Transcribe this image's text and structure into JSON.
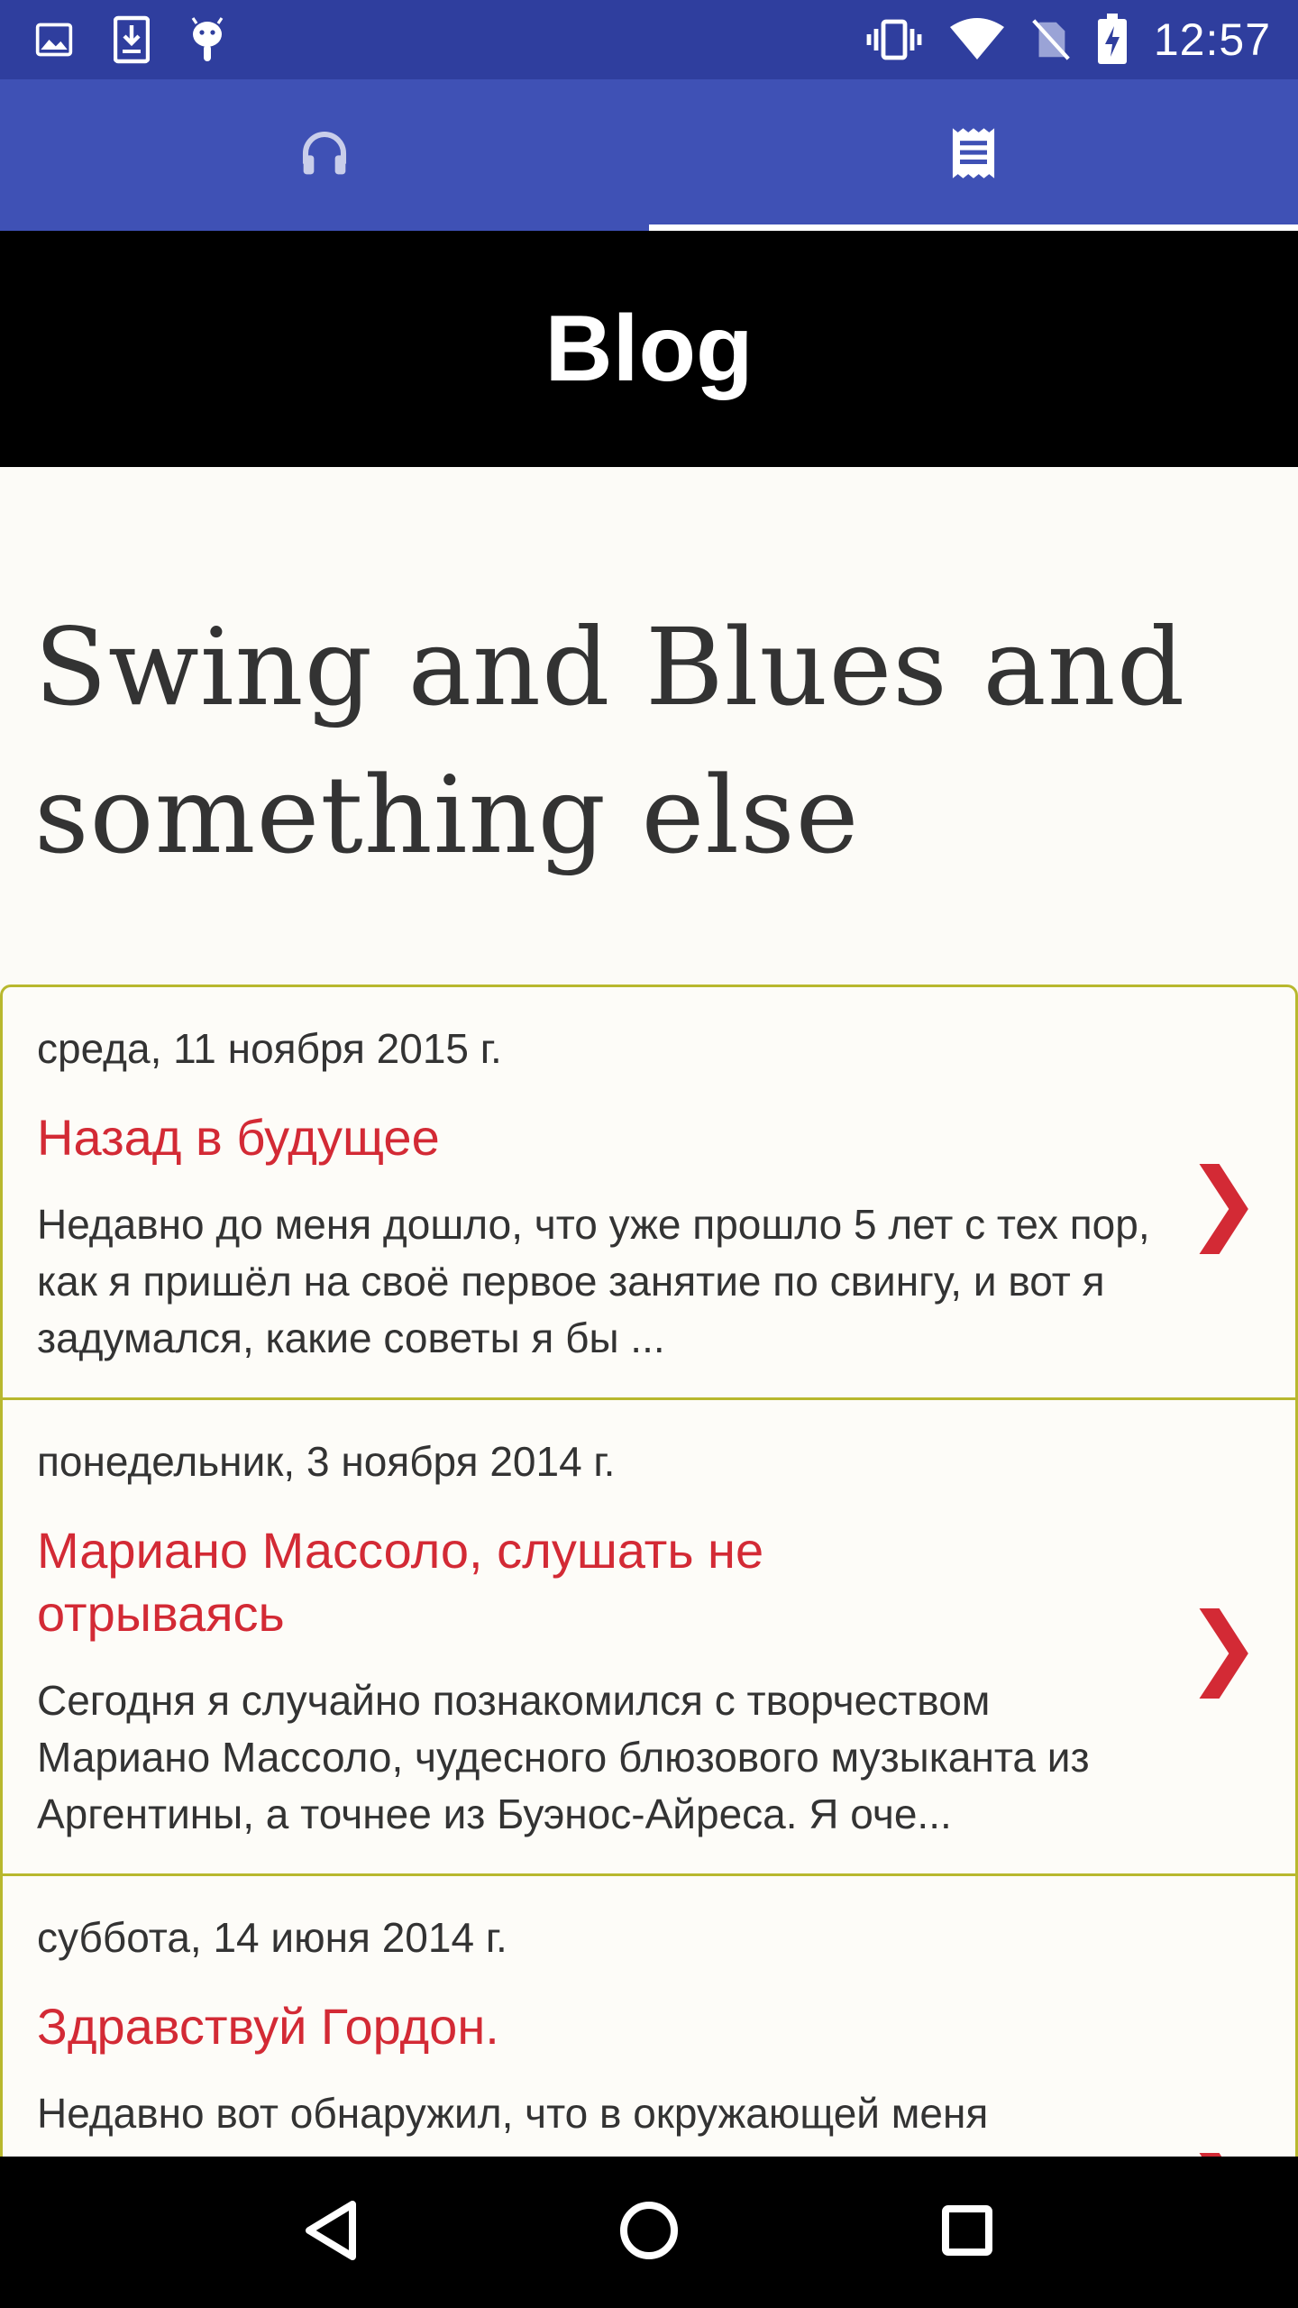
{
  "status_bar": {
    "time": "12:57",
    "left_icons": [
      "image-icon",
      "download-icon",
      "android-icon"
    ],
    "right_icons": [
      "vibrate-icon",
      "wifi-icon",
      "no-sim-icon",
      "battery-charging-icon"
    ]
  },
  "tabs": [
    {
      "icon": "headphones-icon",
      "active": false
    },
    {
      "icon": "blog-receipt-icon",
      "active": true
    }
  ],
  "header": {
    "title": "Blog"
  },
  "page": {
    "title": "Swing and Blues and something else"
  },
  "posts": [
    {
      "date": "среда, 11 ноября 2015 г.",
      "title": "Назад в будущее",
      "excerpt": "Недавно до меня дошло, что уже прошло 5 лет с тех пор, как я пришёл на своё первое занятие по свингу, и вот я задумался, какие советы я бы ...",
      "chevron": "❯"
    },
    {
      "date": "понедельник, 3 ноября 2014 г.",
      "title": "Мариано Массоло, слушать не отрываясь",
      "excerpt": "Сегодня я случайно познакомился с творчеством Мариано Массоло, чудесного блюзового музыканта из Аргентины, а точнее из Буэнос-Айреса. Я оче...",
      "chevron": "❯"
    },
    {
      "date": "суббота, 14 июня 2014 г.",
      "title": "Здравствуй Гордон.",
      "excerpt": "Недавно вот обнаружил, что в окружающей меня",
      "chevron": "❯"
    }
  ],
  "nav_bar": [
    "back-icon",
    "home-icon",
    "recents-icon"
  ],
  "colors": {
    "status_bar": "#2f3e9e",
    "tab_bar": "#3f51b5",
    "accent_red": "#d32a35",
    "card_border": "#b8b82e",
    "content_bg": "#fcfbf7"
  }
}
